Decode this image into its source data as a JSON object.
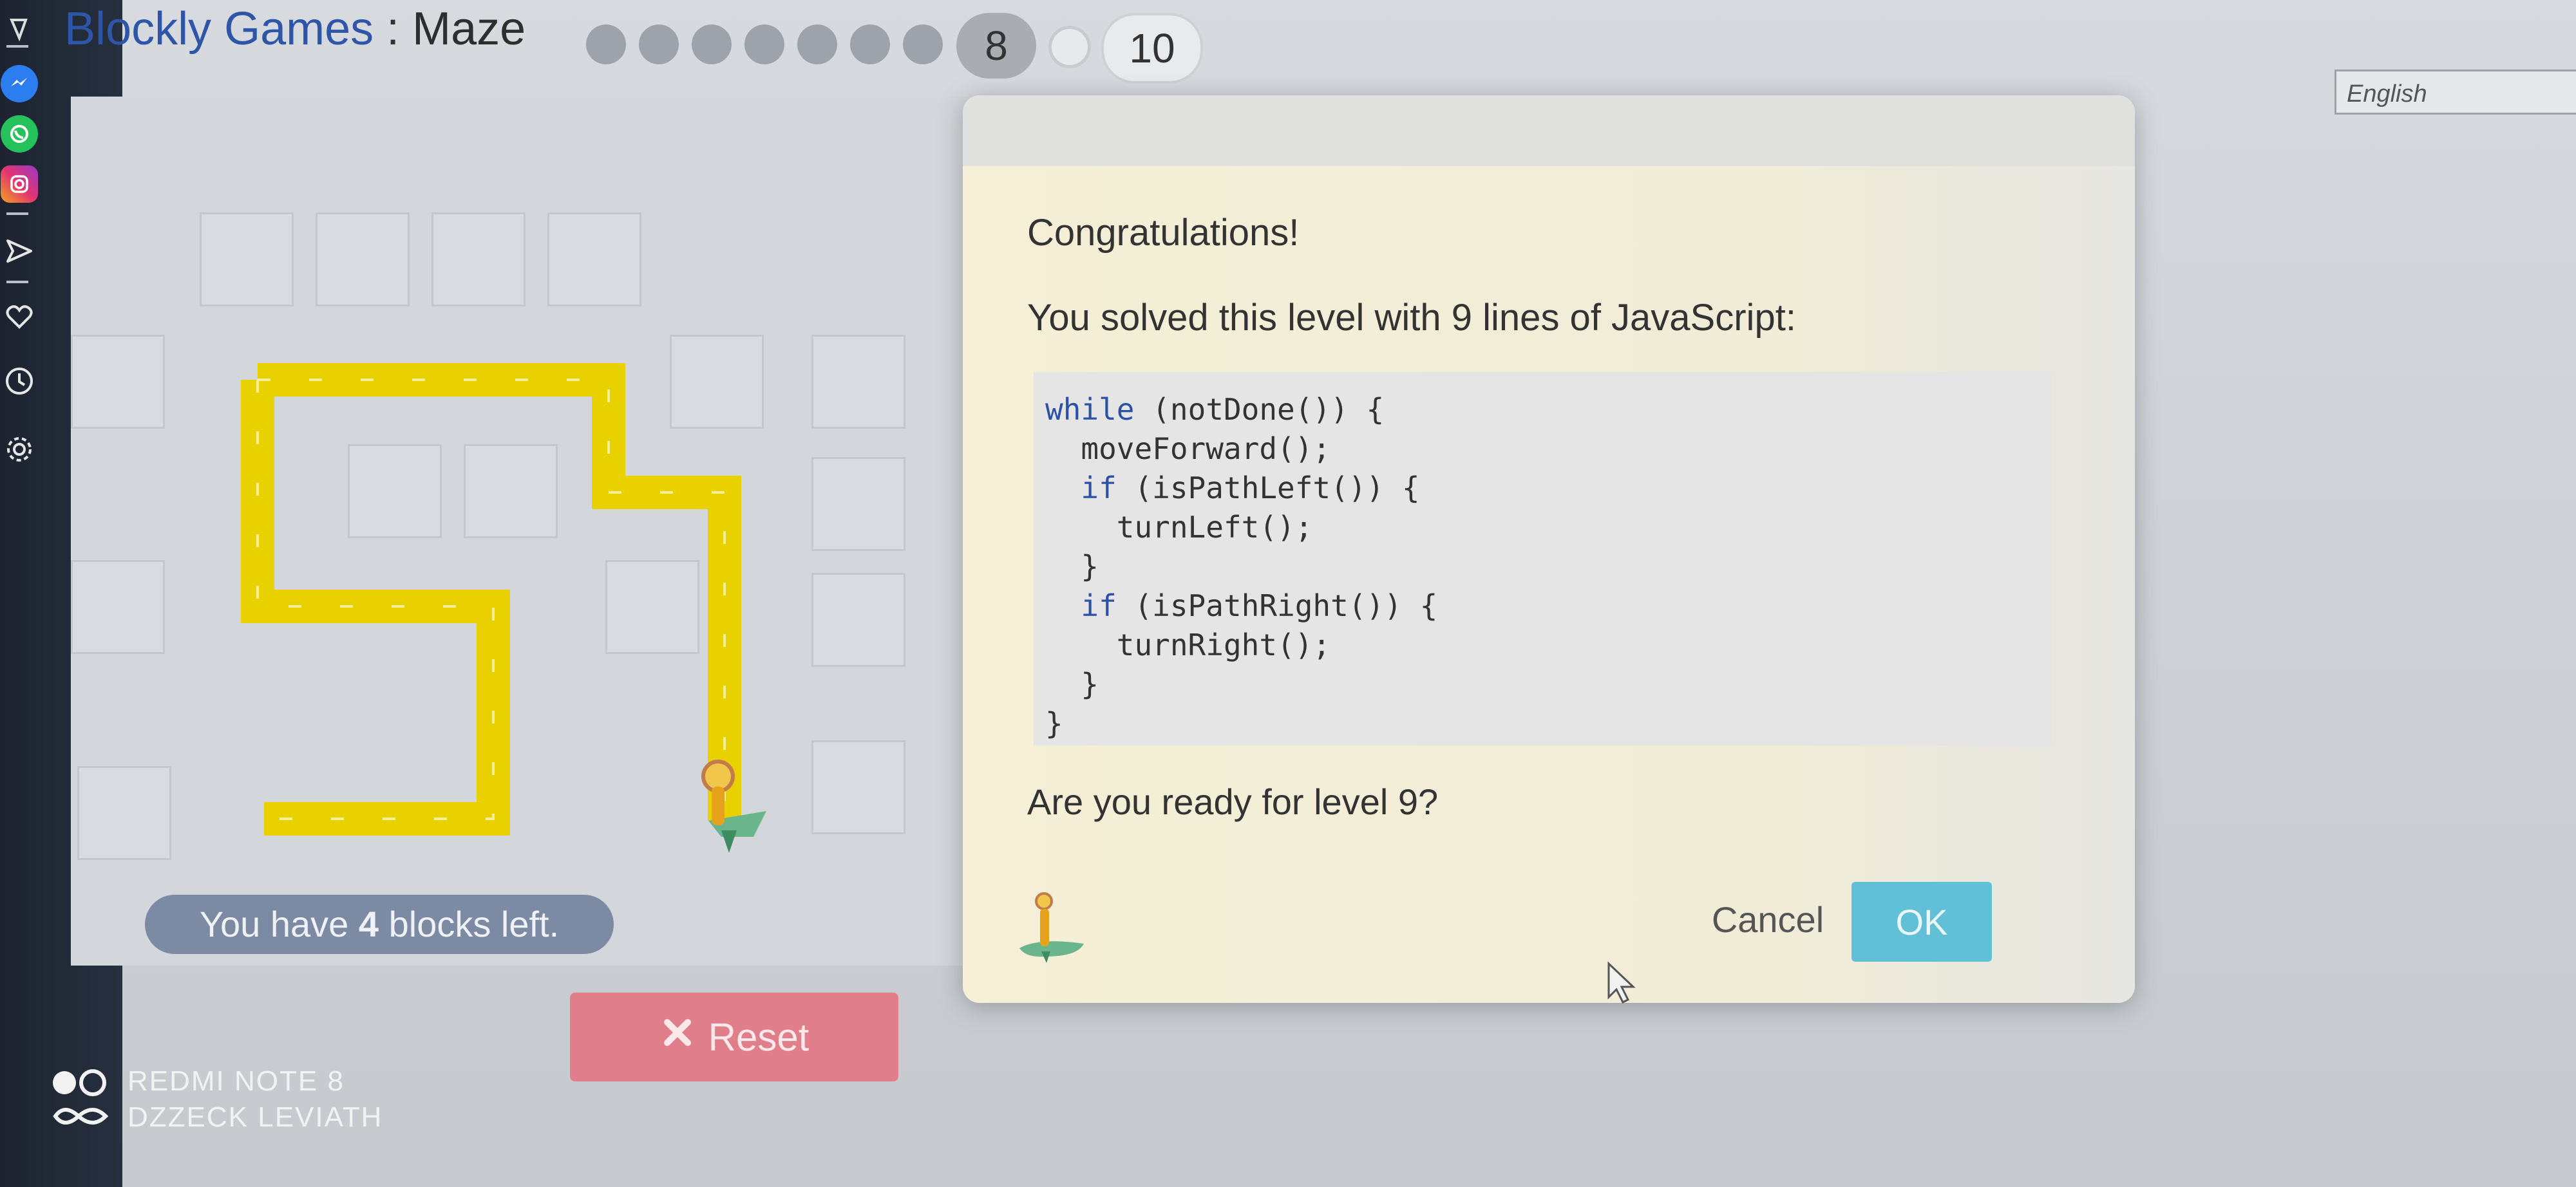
{
  "app": {
    "title_main": "Blockly Games",
    "title_sep": " : ",
    "title_sub": "Maze"
  },
  "levels": {
    "current": "8",
    "next_label": "10"
  },
  "language": {
    "selected": "English"
  },
  "maze": {
    "blocks_left_prefix": "You have ",
    "blocks_left_count": "4",
    "blocks_left_suffix": " blocks left.",
    "reset_label": "Reset"
  },
  "dialog": {
    "heading": "Congratulations!",
    "message": "You solved this level with 9 lines of JavaScript:",
    "code_lines": [
      "while (notDone()) {",
      "  moveForward();",
      "  if (isPathLeft()) {",
      "    turnLeft();",
      "  }",
      "  if (isPathRight()) {",
      "    turnRight();",
      "  }",
      "}"
    ],
    "question": "Are you ready for level 9?",
    "cancel_label": "Cancel",
    "ok_label": "OK"
  },
  "watermark": {
    "line1": "REDMI NOTE 8",
    "line2": "DZZECK LEVIATH"
  },
  "colors": {
    "title_blue": "#2f55a8",
    "path_yellow": "#e9d100",
    "ok_button": "#61c0d6",
    "reset_button": "#e07f8b",
    "blocks_pill": "#7d8aa3"
  }
}
